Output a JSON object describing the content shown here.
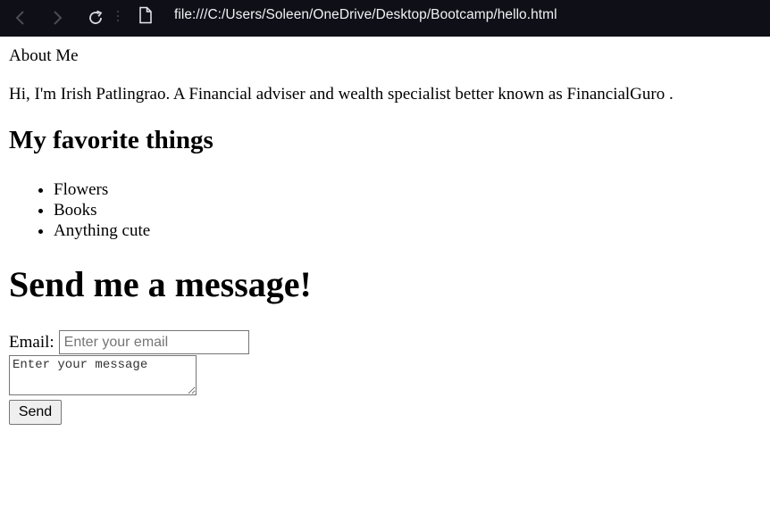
{
  "browser": {
    "url": "file:///C:/Users/Soleen/OneDrive/Desktop/Bootcamp/hello.html",
    "icons": [
      "back-icon",
      "forward-icon",
      "reload-icon",
      "file-icon"
    ],
    "bar_color": "#0f0f17"
  },
  "page": {
    "about_label": "About Me",
    "intro": "Hi, I'm Irish Patlingrao. A Financial adviser and wealth specialist better known as FinancialGuro .",
    "favorites_heading": "My favorite things",
    "favorites": [
      "Flowers",
      "Books",
      "Anything cute"
    ],
    "message_heading": "Send me a message!",
    "form": {
      "email_label": "Email:",
      "email_placeholder": "Enter your email",
      "email_value": "",
      "message_placeholder": "Enter your message",
      "message_value": "",
      "send_label": "Send"
    }
  }
}
